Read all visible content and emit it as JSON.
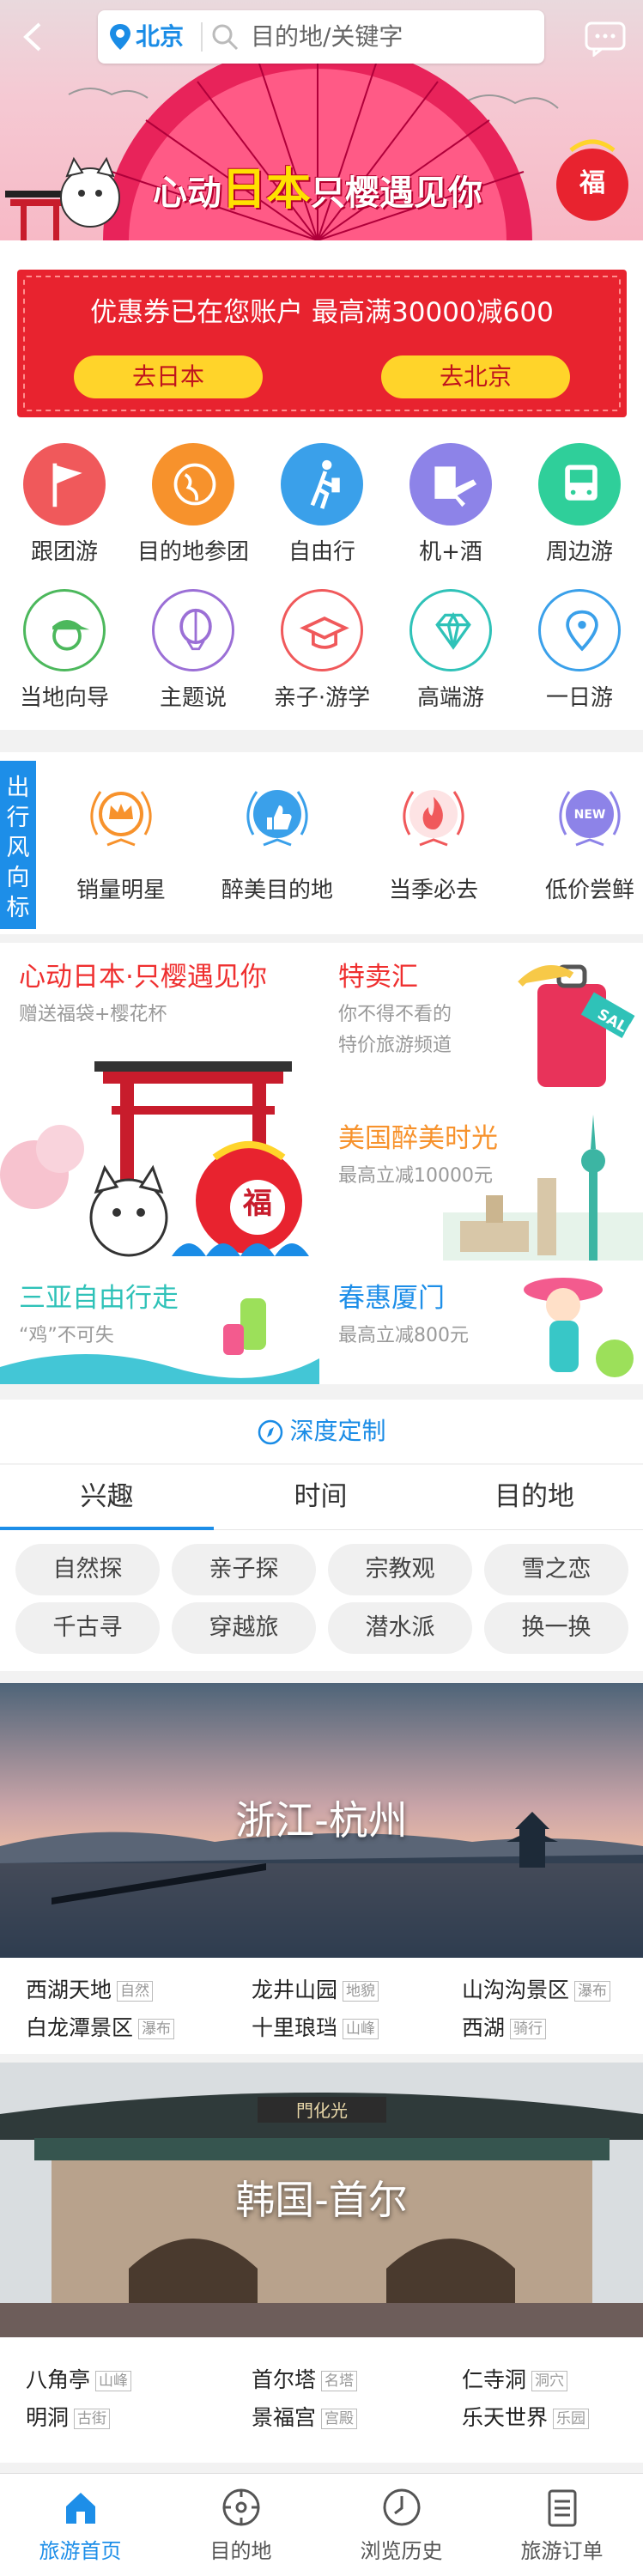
{
  "header": {
    "city": "北京",
    "search_placeholder": "目的地/关键字"
  },
  "hero": {
    "title_part1": "心动",
    "title_big": "日本",
    "title_part2": "只樱遇见你",
    "badge": "福"
  },
  "coupon": {
    "text": "优惠券已在您账户 最高满30000减600",
    "btn_left": "去日本",
    "btn_right": "去北京"
  },
  "grid_row1": [
    {
      "label": "跟团游",
      "icon": "flag-icon",
      "color": "#f0595b"
    },
    {
      "label": "目的地参团",
      "icon": "globe-icon",
      "color": "#f7922c"
    },
    {
      "label": "自由行",
      "icon": "walking-traveler-icon",
      "color": "#3aa0ea"
    },
    {
      "label": "机+酒",
      "icon": "plane-hotel-icon",
      "color": "#8d83e8"
    },
    {
      "label": "周边游",
      "icon": "bus-icon",
      "color": "#2fcf9a"
    }
  ],
  "grid_row2": [
    {
      "label": "当地向导",
      "icon": "guide-cap-icon",
      "color": "#4cb85c"
    },
    {
      "label": "主题说",
      "icon": "hot-air-balloon-icon",
      "color": "#9b6fd6"
    },
    {
      "label": "亲子·游学",
      "icon": "graduation-cap-icon",
      "color": "#f0595b"
    },
    {
      "label": "高端游",
      "icon": "diamond-icon",
      "color": "#2fc2b8"
    },
    {
      "label": "一日游",
      "icon": "map-pin-icon",
      "color": "#3aa0ea"
    }
  ],
  "trends": {
    "tag": "出行风向标",
    "items": [
      {
        "label": "销量明星",
        "icon": "crown-icon",
        "color": "#f7922c"
      },
      {
        "label": "醉美目的地",
        "icon": "thumbs-up-icon",
        "color": "#3aa0ea"
      },
      {
        "label": "当季必去",
        "icon": "flame-icon",
        "color": "#f0595b"
      },
      {
        "label": "低价尝鲜",
        "icon": "new-badge-icon",
        "color": "#8d83e8",
        "badge": "NEW"
      }
    ]
  },
  "promo": {
    "japan": {
      "title": "心动日本·只樱遇见你",
      "sub": "赠送福袋+樱花杯"
    },
    "sale": {
      "title": "特卖汇",
      "sub1": "你不得不看的",
      "sub2": "特价旅游频道",
      "tag": "SALE"
    },
    "usa": {
      "title": "美国醉美时光",
      "sub": "最高立减10000元"
    },
    "sanya": {
      "title": "三亚自由行走",
      "sub": "“鸡”不可失"
    },
    "xiamen": {
      "title": "春惠厦门",
      "sub": "最高立减800元"
    }
  },
  "custom": {
    "label": "深度定制"
  },
  "tabs": [
    "兴趣",
    "时间",
    "目的地"
  ],
  "chips": [
    "自然探",
    "亲子探",
    "宗教观",
    "雪之恋",
    "千古寻",
    "穿越旅",
    "潜水派",
    "换一换"
  ],
  "dest1": {
    "name": "浙江-杭州",
    "spots": [
      {
        "name": "西湖天地",
        "tag": "自然"
      },
      {
        "name": "龙井山园",
        "tag": "地貌"
      },
      {
        "name": "山沟沟景区",
        "tag": "瀑布"
      },
      {
        "name": "白龙潭景区",
        "tag": "瀑布"
      },
      {
        "name": "十里琅珰",
        "tag": "山峰"
      },
      {
        "name": "西湖",
        "tag": "骑行"
      }
    ]
  },
  "dest2": {
    "name": "韩国-首尔",
    "gate_sign": "門化光",
    "spots": [
      {
        "name": "八角亭",
        "tag": "山峰"
      },
      {
        "name": "首尔塔",
        "tag": "名塔"
      },
      {
        "name": "仁寺洞",
        "tag": "洞穴"
      },
      {
        "name": "明洞",
        "tag": "古街"
      },
      {
        "name": "景福宫",
        "tag": "宫殿"
      },
      {
        "name": "乐天世界",
        "tag": "乐园"
      }
    ]
  },
  "bottom_nav": [
    {
      "label": "旅游首页",
      "icon": "home-icon",
      "active": true
    },
    {
      "label": "目的地",
      "icon": "compass-icon"
    },
    {
      "label": "浏览历史",
      "icon": "clock-icon"
    },
    {
      "label": "旅游订单",
      "icon": "order-list-icon"
    }
  ],
  "colors": {
    "accent": "#1d8ee8",
    "red": "#e8232f",
    "yellow": "#ffd42a"
  }
}
